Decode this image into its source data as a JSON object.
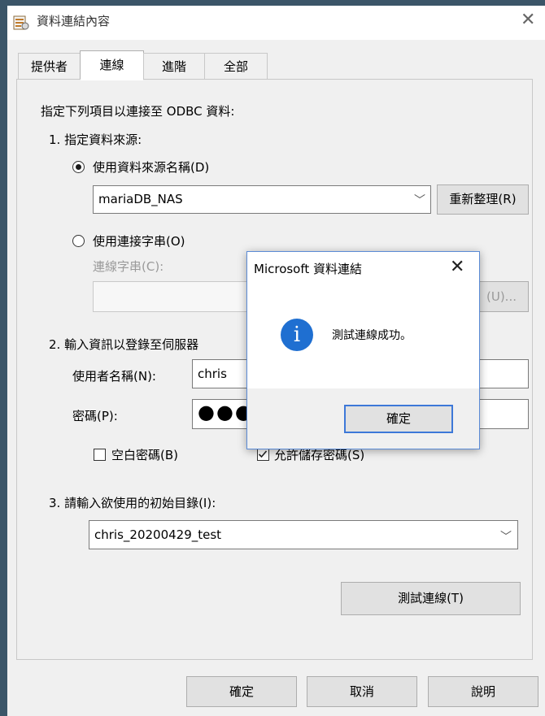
{
  "window": {
    "title": "資料連結內容",
    "icon": "data-link-icon",
    "close_glyph": "✕"
  },
  "tabs": [
    {
      "label": "提供者",
      "active": false
    },
    {
      "label": "連線",
      "active": true
    },
    {
      "label": "進階",
      "active": false
    },
    {
      "label": "全部",
      "active": false
    }
  ],
  "connection": {
    "instruction": "指定下列項目以連接至 ODBC 資料:",
    "step1_label": "1. 指定資料來源:",
    "dsn_radio_label": "使用資料來源名稱(D)",
    "dsn_value": "mariaDB_NAS",
    "refresh_button": "重新整理(R)",
    "connstr_radio_label": "使用連接字串(O)",
    "connstr_label": "連線字串(C):",
    "build_button": "(U)...",
    "step2_label": "2. 輸入資訊以登錄至伺服器",
    "username_label": "使用者名稱(N):",
    "username_value": "chris",
    "password_label": "密碼(P):",
    "password_mask": "●●●",
    "blank_password_label": "空白密碼(B)",
    "allow_save_label": "允許儲存密碼(S)",
    "step3_label": "3. 請輸入欲使用的初始目錄(I):",
    "catalog_value": "chris_20200429_test",
    "test_button": "測試連線(T)"
  },
  "footer": {
    "ok_button": "確定",
    "cancel_button": "取消",
    "help_button": "說明"
  },
  "message_box": {
    "title": "Microsoft 資料連結",
    "close_glyph": "✕",
    "icon": "info-icon",
    "message": "測試連線成功。",
    "ok_button": "確定",
    "accent_color": "#1f6fd1"
  }
}
